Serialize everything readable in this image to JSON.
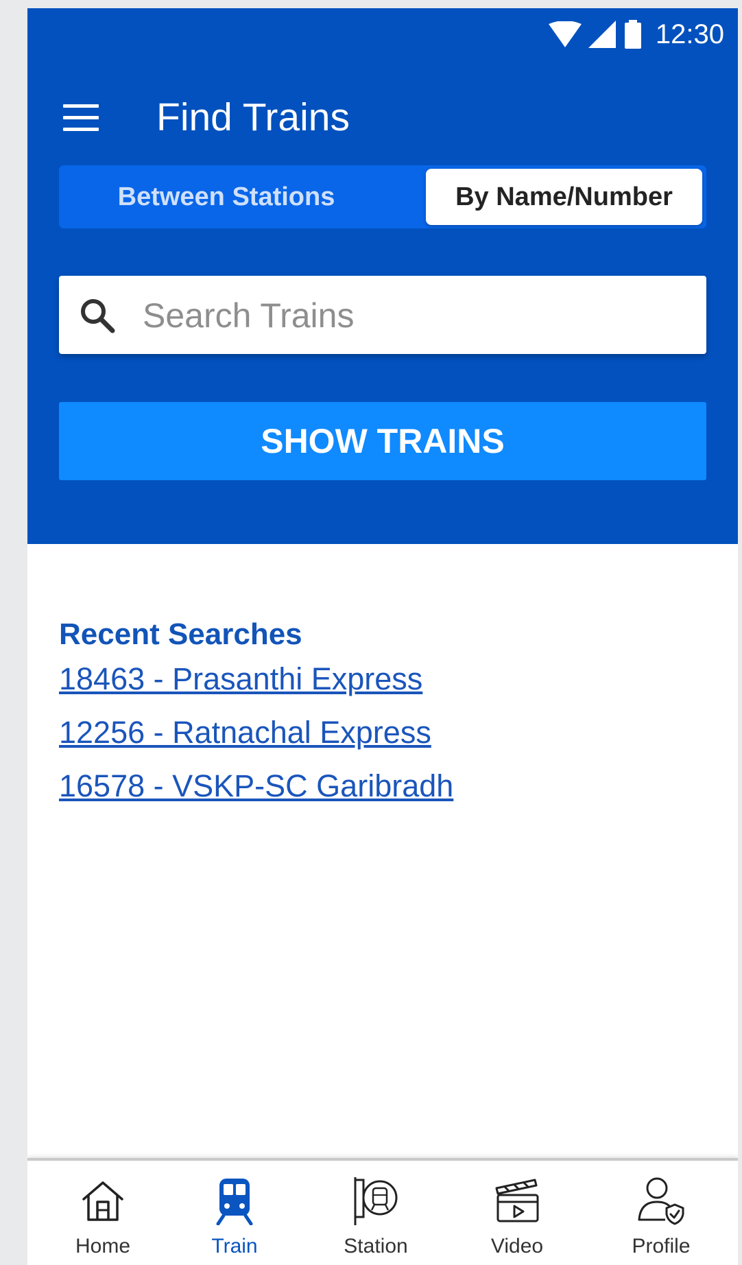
{
  "status_bar": {
    "time": "12:30"
  },
  "header": {
    "title": "Find Trains"
  },
  "segments": {
    "between_label": "Between Stations",
    "byname_label": "By Name/Number",
    "selected": "byname"
  },
  "search": {
    "placeholder": "Search Trains",
    "value": ""
  },
  "show_button": {
    "label": "SHOW TRAINS"
  },
  "recent": {
    "title": "Recent Searches",
    "items": [
      "18463 - Prasanthi Express",
      "12256 - Ratnachal Express",
      "16578 - VSKP-SC Garibradh"
    ]
  },
  "bottom_nav": {
    "items": [
      {
        "label": "Home",
        "icon": "home-icon"
      },
      {
        "label": "Train",
        "icon": "train-icon"
      },
      {
        "label": "Station",
        "icon": "station-icon"
      },
      {
        "label": "Video",
        "icon": "video-icon"
      },
      {
        "label": "Profile",
        "icon": "profile-icon"
      }
    ],
    "active": "Train"
  },
  "colors": {
    "header_bg": "#0251be",
    "segment_bg": "#0966e9",
    "button_bg": "#108aff",
    "link": "#1a55bb",
    "active_nav": "#0a55c0"
  }
}
